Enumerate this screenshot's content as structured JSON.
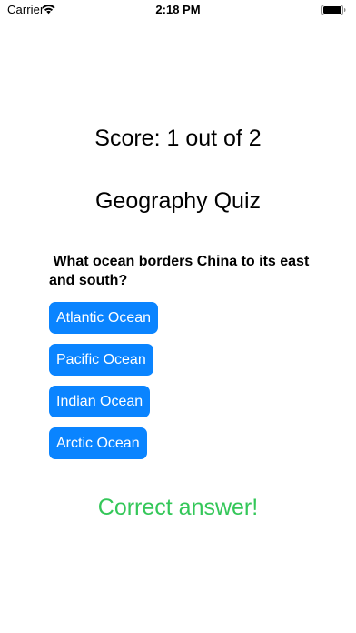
{
  "status_bar": {
    "carrier": "Carrier",
    "time": "2:18 PM"
  },
  "quiz": {
    "score_text": "Score: 1 out of 2",
    "title": "Geography Quiz",
    "question": " What ocean borders China to its east and south?",
    "answers": [
      {
        "label": "Atlantic Ocean"
      },
      {
        "label": "Pacific Ocean"
      },
      {
        "label": "Indian Ocean"
      },
      {
        "label": "Arctic Ocean"
      }
    ],
    "feedback": "Correct answer!"
  },
  "colors": {
    "button": "#0a84ff",
    "button_text": "#ffffff",
    "feedback": "#34c759"
  },
  "icons": [
    "wifi-icon",
    "battery-icon"
  ]
}
